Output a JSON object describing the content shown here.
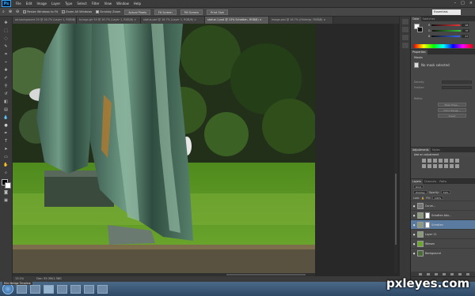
{
  "app": {
    "logo": "Ps"
  },
  "menu": [
    "File",
    "Edit",
    "Image",
    "Layer",
    "Type",
    "Select",
    "Filter",
    "View",
    "Window",
    "Help"
  ],
  "window_controls": [
    "–",
    "□",
    "×"
  ],
  "options_bar": {
    "tool_icon": "zoom-icon",
    "checks": [
      "Resize Windows to Fit",
      "Zoom All Windows",
      "Scrubby Zoom"
    ],
    "buttons": [
      "Actual Pixels",
      "Fit Screen",
      "Fill Screen",
      "Print Size"
    ]
  },
  "workspace": "Essentials",
  "tabs": [
    "oe-background 20 @ 16.7% (Layer 1, RGB/8) ×",
    "ts-logo-gir 50 @ 16.7% (Layer 1, RGB/8) ×",
    "status.psd @ 16.7% (Layer 1, RGB/8) ×",
    "statue-1.psd @ 13% Schatten, RGB/8) ×",
    "image.psd @ 16.7% (Hintergr, RGB/8) ×"
  ],
  "active_tab": 3,
  "color_panel": {
    "tabs": [
      "Color",
      "Swatches"
    ],
    "sliders": [
      {
        "label": "R",
        "value": "28",
        "color": "#e06060"
      },
      {
        "label": "G",
        "value": "37",
        "color": "#60c060"
      },
      {
        "label": "B",
        "value": "47",
        "color": "#6080e0"
      }
    ]
  },
  "properties": {
    "tab": "Properties",
    "section": "Masks",
    "mask_label": "No mask selected",
    "fields": [
      "Density:",
      "Feather:"
    ],
    "refine_label": "Refine:",
    "buttons": [
      "Mask Edge...",
      "Color Range...",
      "Invert"
    ]
  },
  "adjustments": {
    "tabs": [
      "Adjustments",
      "Styles"
    ],
    "title": "Add an adjustment"
  },
  "layers": {
    "tabs": [
      "Layers",
      "Channels",
      "Paths"
    ],
    "kind": "Kind",
    "blend": "Overlay",
    "opacity_label": "Opacity:",
    "opacity": "50%",
    "lock_label": "Lock:",
    "fill_label": "Fill:",
    "fill": "100%",
    "rows": [
      {
        "name": "Curve...",
        "eye": "●",
        "selected": false
      },
      {
        "name": "Schatten bäu...",
        "eye": "●",
        "selected": false
      },
      {
        "name": "Schatten",
        "eye": "●",
        "selected": true
      },
      {
        "name": "Layer 11",
        "eye": "●",
        "selected": false
      },
      {
        "name": "Wiesen",
        "eye": "●",
        "selected": false
      },
      {
        "name": "Background",
        "eye": "●",
        "selected": false
      }
    ]
  },
  "status": {
    "zoom": "13.1%",
    "doc": "Doc: 55.3M/1.38G"
  },
  "taskbar": {
    "label": "Mini Bridge  Timeline"
  },
  "watermark": "pxleyes.com"
}
